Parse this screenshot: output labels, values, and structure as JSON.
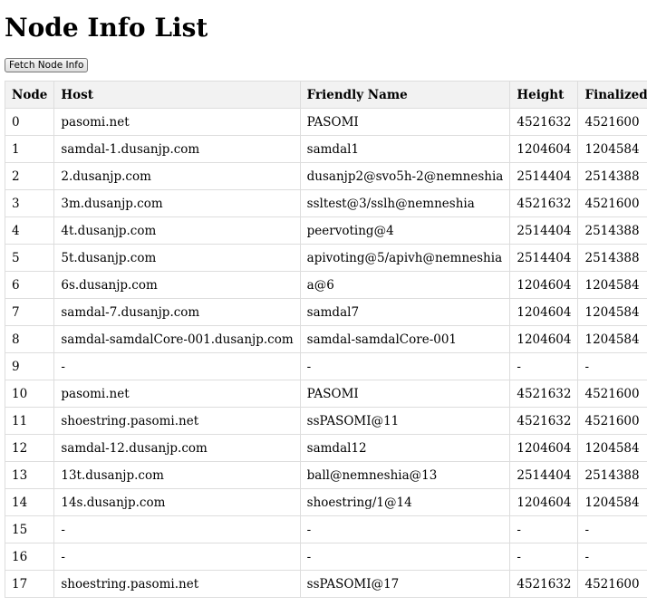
{
  "page": {
    "title": "Node Info List",
    "fetch_button_label": "Fetch Node Info"
  },
  "table": {
    "headers": [
      "Node",
      "Host",
      "Friendly Name",
      "Height",
      "Finalized"
    ],
    "rows": [
      [
        "0",
        "pasomi.net",
        "PASOMI",
        "4521632",
        "4521600"
      ],
      [
        "1",
        "samdal-1.dusanjp.com",
        "samdal1",
        "1204604",
        "1204584"
      ],
      [
        "2",
        "2.dusanjp.com",
        "dusanjp2@svo5h-2@nemneshia",
        "2514404",
        "2514388"
      ],
      [
        "3",
        "3m.dusanjp.com",
        "ssltest@3/sslh@nemneshia",
        "4521632",
        "4521600"
      ],
      [
        "4",
        "4t.dusanjp.com",
        "peervoting@4",
        "2514404",
        "2514388"
      ],
      [
        "5",
        "5t.dusanjp.com",
        "apivoting@5/apivh@nemneshia",
        "2514404",
        "2514388"
      ],
      [
        "6",
        "6s.dusanjp.com",
        "a@6",
        "1204604",
        "1204584"
      ],
      [
        "7",
        "samdal-7.dusanjp.com",
        "samdal7",
        "1204604",
        "1204584"
      ],
      [
        "8",
        "samdal-samdalCore-001.dusanjp.com",
        "samdal-samdalCore-001",
        "1204604",
        "1204584"
      ],
      [
        "9",
        "-",
        "-",
        "-",
        "-"
      ],
      [
        "10",
        "pasomi.net",
        "PASOMI",
        "4521632",
        "4521600"
      ],
      [
        "11",
        "shoestring.pasomi.net",
        "ssPASOMI@11",
        "4521632",
        "4521600"
      ],
      [
        "12",
        "samdal-12.dusanjp.com",
        "samdal12",
        "1204604",
        "1204584"
      ],
      [
        "13",
        "13t.dusanjp.com",
        "ball@nemneshia@13",
        "2514404",
        "2514388"
      ],
      [
        "14",
        "14s.dusanjp.com",
        "shoestring/1@14",
        "1204604",
        "1204584"
      ],
      [
        "15",
        "-",
        "-",
        "-",
        "-"
      ],
      [
        "16",
        "-",
        "-",
        "-",
        "-"
      ],
      [
        "17",
        "shoestring.pasomi.net",
        "ssPASOMI@17",
        "4521632",
        "4521600"
      ]
    ]
  }
}
